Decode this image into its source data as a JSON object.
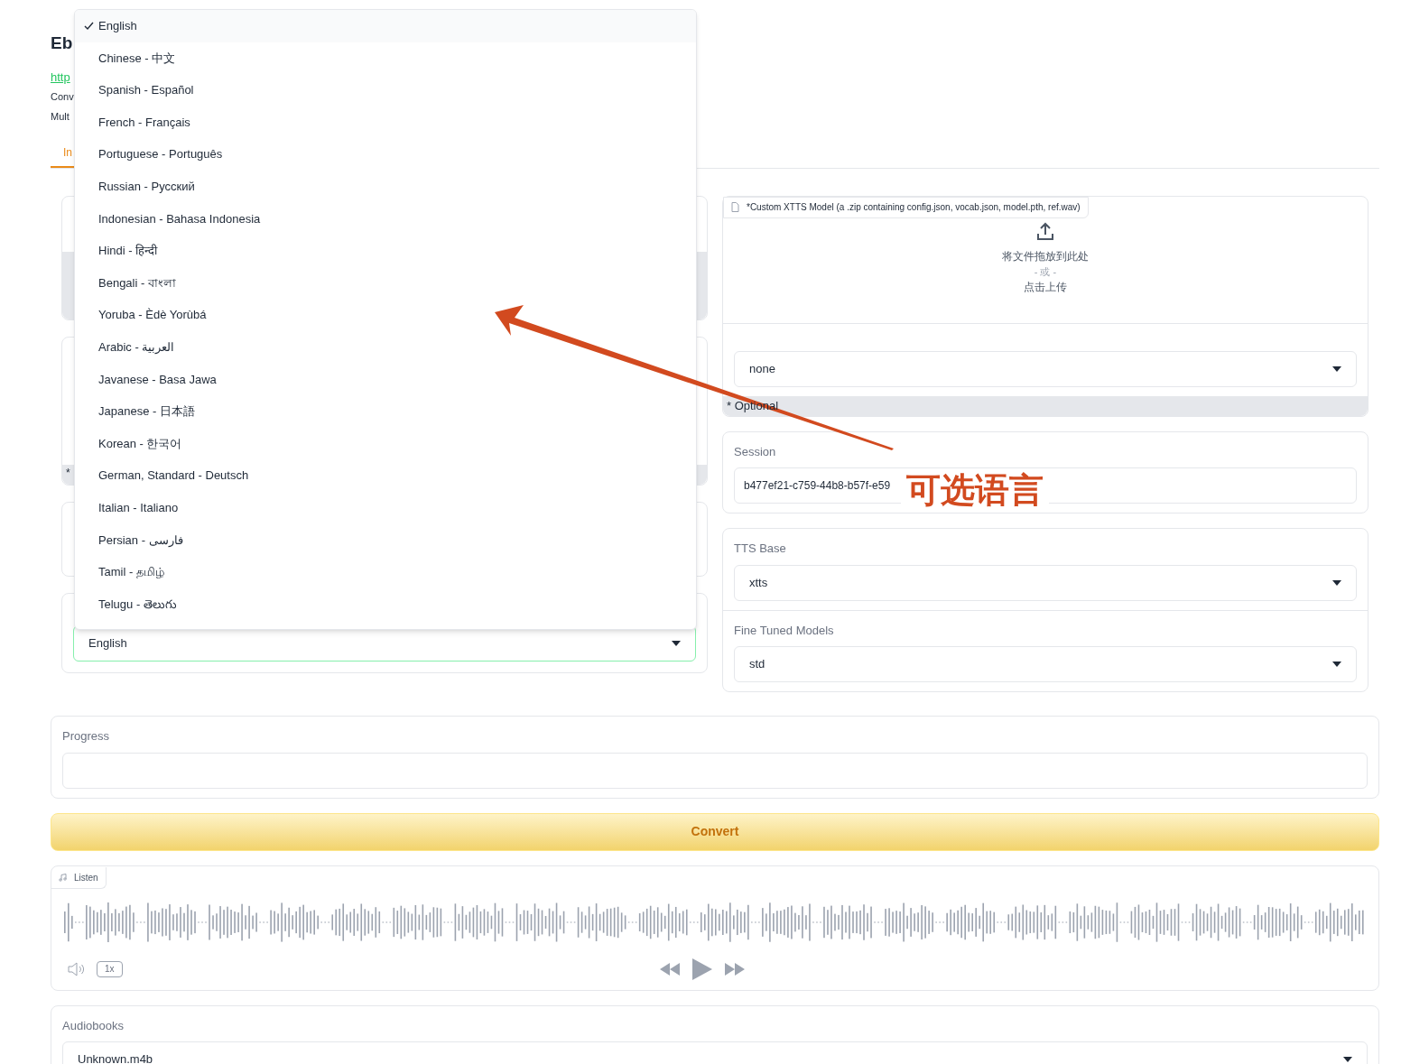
{
  "header": {
    "title": "Eb",
    "link": "http",
    "lines": [
      "Conv",
      "Mult"
    ]
  },
  "tabs": [
    {
      "label": "In",
      "selected": true
    }
  ],
  "left_panels": [
    {
      "footer": "*"
    }
  ],
  "language_select": {
    "value": "English",
    "expanded": true,
    "options": [
      {
        "label": "English",
        "selected": true
      },
      {
        "label": "Chinese - 中文",
        "selected": false
      },
      {
        "label": "Spanish - Español",
        "selected": false
      },
      {
        "label": "French - Français",
        "selected": false
      },
      {
        "label": "Portuguese - Português",
        "selected": false
      },
      {
        "label": "Russian - Русский",
        "selected": false
      },
      {
        "label": "Indonesian - Bahasa Indonesia",
        "selected": false
      },
      {
        "label": "Hindi - हिन्दी",
        "selected": false
      },
      {
        "label": "Bengali - বাংলা",
        "selected": false
      },
      {
        "label": "Yoruba - Èdè Yorùbá",
        "selected": false
      },
      {
        "label": "Arabic - العربية",
        "selected": false
      },
      {
        "label": "Javanese - Basa Jawa",
        "selected": false
      },
      {
        "label": "Japanese - 日本語",
        "selected": false
      },
      {
        "label": "Korean - 한국어",
        "selected": false
      },
      {
        "label": "German, Standard - Deutsch",
        "selected": false
      },
      {
        "label": "Italian - Italiano",
        "selected": false
      },
      {
        "label": "Persian - فارسی",
        "selected": false
      },
      {
        "label": "Tamil - தமிழ்",
        "selected": false
      },
      {
        "label": "Telugu - తెలుగు",
        "selected": false
      }
    ]
  },
  "custom_model": {
    "label": "*Custom XTTS Model (a .zip containing config.json, vocab.json, model.pth, ref.wav)",
    "drop_text": "将文件拖放到此处",
    "or_text": "- 或 -",
    "click_text": "点击上传",
    "select_value": "none",
    "footer": "* Optional"
  },
  "session": {
    "label": "Session",
    "value": "b477ef21-c759-44b8-b57f-e59"
  },
  "tts_base": {
    "label": "TTS Base",
    "value": "xtts"
  },
  "fine_tuned": {
    "label": "Fine Tuned Models",
    "value": "std"
  },
  "progress": {
    "label": "Progress"
  },
  "convert_button": "Convert",
  "listen": {
    "label": "Listen",
    "speed": "1x"
  },
  "audiobooks": {
    "label": "Audiobooks",
    "value": "Unknown.m4b"
  },
  "annotation": {
    "text": "可选语言"
  }
}
